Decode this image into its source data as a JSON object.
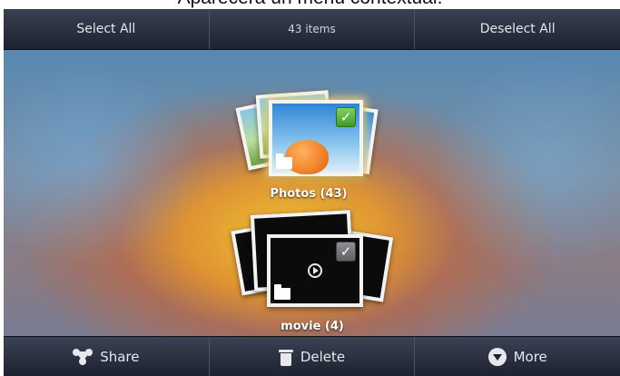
{
  "caption": "Aparecerá un menú contextual.",
  "topbar": {
    "select_all": "Select All",
    "item_count": "43 items",
    "deselect_all": "Deselect All"
  },
  "albums": [
    {
      "label": "Photos  (43)",
      "icon": "photo-stack",
      "selected": true
    },
    {
      "label": "movie  (4)",
      "icon": "video-stack",
      "selected": true
    }
  ],
  "bottombar": {
    "share": "Share",
    "delete": "Delete",
    "more": "More"
  },
  "colors": {
    "bar": "#1d2230",
    "check_selected": "#3f9b26",
    "check_grey": "#5e6064",
    "glow": "#f4c42d"
  }
}
